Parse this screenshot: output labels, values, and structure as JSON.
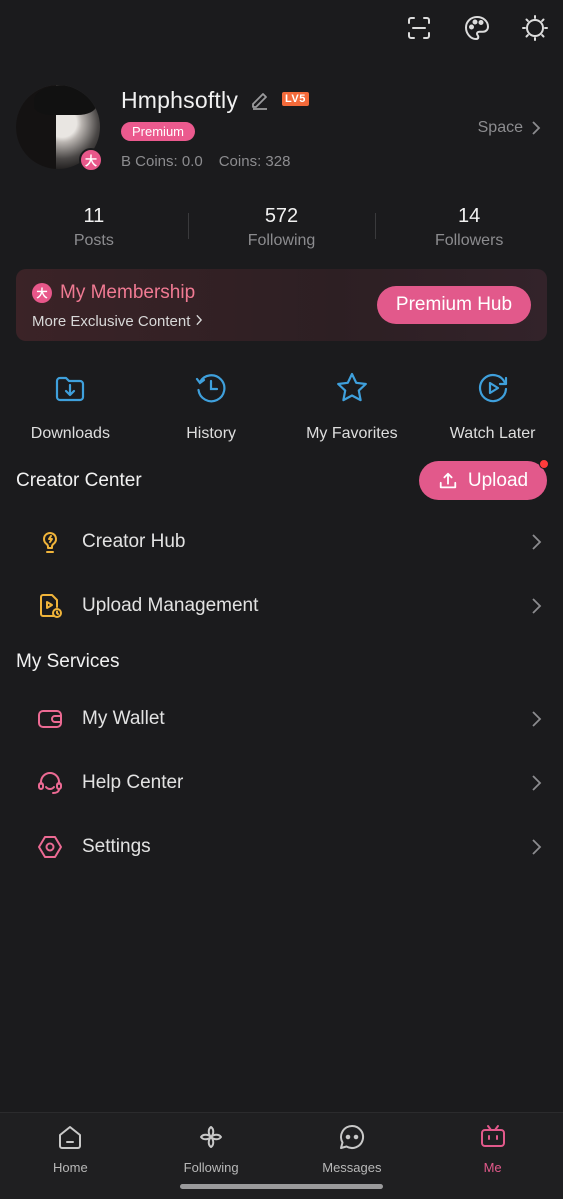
{
  "colors": {
    "accent": "#e2598b",
    "background": "#1b1b1d",
    "blue_icon": "#3fa0dc",
    "yellow_icon": "#f0b43a"
  },
  "topbar": {
    "icons": [
      "scan-icon",
      "palette-icon",
      "theme-icon"
    ]
  },
  "profile": {
    "username": "Hmphsoftly",
    "level": "LV5",
    "premium_label": "Premium",
    "avatar_badge": "大",
    "b_coins": "B Coins: 0.0",
    "coins": "Coins: 328",
    "space_label": "Space"
  },
  "stats": [
    {
      "value": "11",
      "label": "Posts"
    },
    {
      "value": "572",
      "label": "Following"
    },
    {
      "value": "14",
      "label": "Followers"
    }
  ],
  "membership": {
    "icon_text": "大",
    "title": "My Membership",
    "subtitle": "More Exclusive Content",
    "button": "Premium Hub"
  },
  "quick_actions": [
    {
      "label": "Downloads",
      "icon": "download-icon"
    },
    {
      "label": "History",
      "icon": "history-icon"
    },
    {
      "label": "My Favorites",
      "icon": "star-icon"
    },
    {
      "label": "Watch Later",
      "icon": "watch-later-icon"
    }
  ],
  "creator_center": {
    "title": "Creator Center",
    "upload_button": "Upload",
    "items": [
      {
        "label": "Creator Hub",
        "icon": "lightbulb-icon"
      },
      {
        "label": "Upload Management",
        "icon": "upload-management-icon"
      }
    ]
  },
  "services": {
    "title": "My Services",
    "items": [
      {
        "label": "My Wallet",
        "icon": "wallet-icon"
      },
      {
        "label": "Help Center",
        "icon": "headset-icon"
      },
      {
        "label": "Settings",
        "icon": "settings-icon"
      }
    ]
  },
  "tabbar": [
    {
      "label": "Home",
      "icon": "home-icon"
    },
    {
      "label": "Following",
      "icon": "pinwheel-icon"
    },
    {
      "label": "Messages",
      "icon": "messages-icon"
    },
    {
      "label": "Me",
      "icon": "tv-icon",
      "active": true
    }
  ]
}
